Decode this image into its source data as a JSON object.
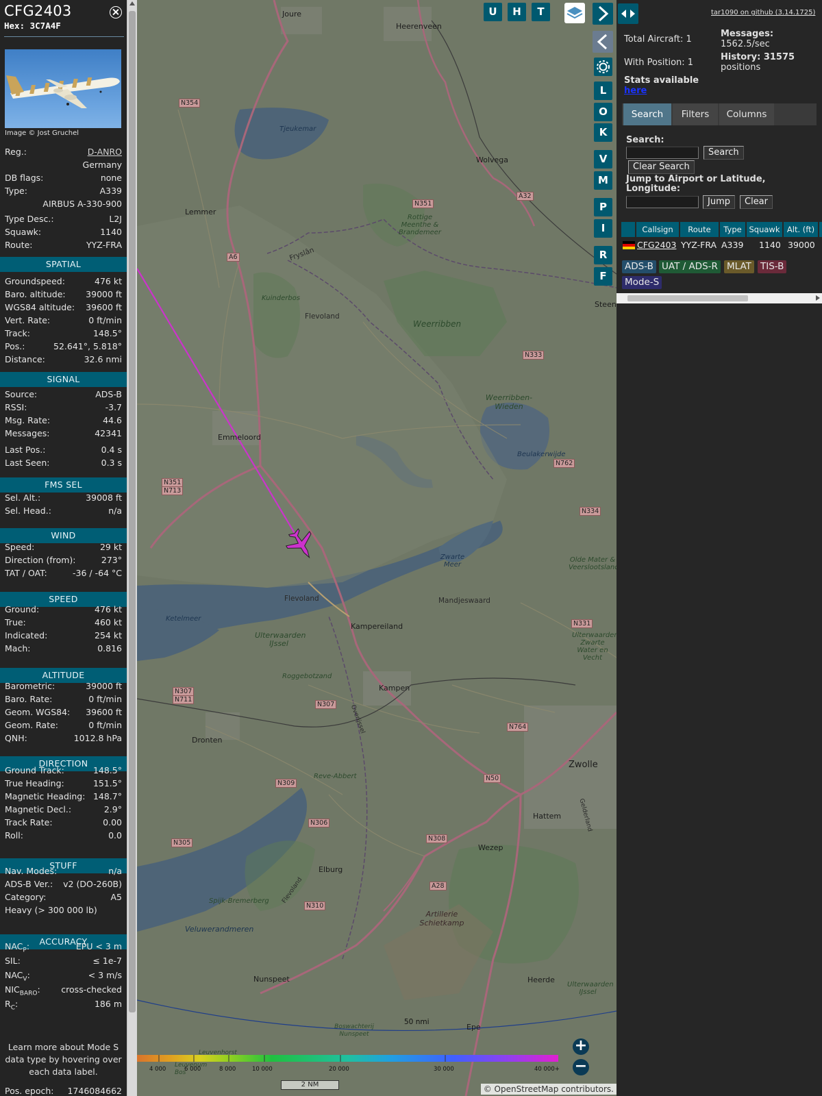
{
  "aircraft": {
    "callsign": "CFG2403",
    "hex": "Hex: 3C7A4F",
    "photo_credit": "Image © Jost Gruchel",
    "basic": [
      {
        "k": "Reg.:",
        "v": "D-ANRO"
      },
      {
        "k": "",
        "v": "Germany"
      },
      {
        "k": "DB flags:",
        "v": "none"
      },
      {
        "k": "Type:",
        "v": "A339"
      },
      {
        "k": "",
        "v": "AIRBUS A-330-900"
      },
      {
        "k": "Type Desc.:",
        "v": "L2J"
      },
      {
        "k": "Squawk:",
        "v": "1140"
      },
      {
        "k": "Route:",
        "v": "YYZ-FRA"
      }
    ],
    "spatial_title": "SPATIAL",
    "spatial": [
      {
        "k": "Groundspeed:",
        "v": "476 kt"
      },
      {
        "k": "Baro. altitude:",
        "v": "39000 ft"
      },
      {
        "k": "WGS84 altitude:",
        "v": "39600 ft"
      },
      {
        "k": "Vert. Rate:",
        "v": "0 ft/min"
      },
      {
        "k": "Track:",
        "v": "148.5°"
      },
      {
        "k": "Pos.:",
        "v": "52.641°, 5.818°"
      },
      {
        "k": "Distance:",
        "v": "32.6 nmi"
      }
    ],
    "signal_title": "SIGNAL",
    "signal": [
      {
        "k": "Source:",
        "v": "ADS-B"
      },
      {
        "k": "RSSI:",
        "v": "-3.7"
      },
      {
        "k": "Msg. Rate:",
        "v": "44.6"
      },
      {
        "k": "Messages:",
        "v": "42341"
      },
      {
        "k": "Last Pos.:",
        "v": "0.4 s"
      },
      {
        "k": "Last Seen:",
        "v": "0.3 s"
      }
    ],
    "fms_title": "FMS SEL",
    "fms": [
      {
        "k": "Sel. Alt.:",
        "v": "39008 ft"
      },
      {
        "k": "Sel. Head.:",
        "v": "n/a"
      }
    ],
    "wind_title": "WIND",
    "wind": [
      {
        "k": "Speed:",
        "v": "29 kt"
      },
      {
        "k": "Direction (from):",
        "v": "273°"
      },
      {
        "k": "TAT / OAT:",
        "v": "-36 / -64 °C"
      }
    ],
    "speed_title": "SPEED",
    "speed": [
      {
        "k": "Ground:",
        "v": "476 kt"
      },
      {
        "k": "True:",
        "v": "460 kt"
      },
      {
        "k": "Indicated:",
        "v": "254 kt"
      },
      {
        "k": "Mach:",
        "v": "0.816"
      }
    ],
    "altitude_title": "ALTITUDE",
    "altitude": [
      {
        "k": "Barometric:",
        "v": "39000 ft"
      },
      {
        "k": "Baro. Rate:",
        "v": "0 ft/min"
      },
      {
        "k": "Geom. WGS84:",
        "v": "39600 ft"
      },
      {
        "k": "Geom. Rate:",
        "v": "0 ft/min"
      },
      {
        "k": "QNH:",
        "v": "1012.8 hPa"
      }
    ],
    "direction_title": "DIRECTION",
    "direction": [
      {
        "k": "Ground Track:",
        "v": "148.5°"
      },
      {
        "k": "True Heading:",
        "v": "151.5°"
      },
      {
        "k": "Magnetic Heading:",
        "v": "148.7°"
      },
      {
        "k": "Magnetic Decl.:",
        "v": "2.9°"
      },
      {
        "k": "Track Rate:",
        "v": "0.00"
      },
      {
        "k": "Roll:",
        "v": "0.0"
      }
    ],
    "stuff_title": "STUFF",
    "stuff": [
      {
        "k": "Nav. Modes:",
        "v": "n/a"
      },
      {
        "k": "ADS-B Ver.:",
        "v": "v2 (DO-260B)"
      },
      {
        "k": "Category:",
        "v": "A5"
      },
      {
        "k": "Heavy (> 300 000 lb)",
        "v": ""
      }
    ],
    "accuracy_title": "ACCURACY",
    "accuracy": [
      {
        "k": "NAC",
        "sub": "P",
        "v": "EPU < 3 m"
      },
      {
        "k": "SIL:",
        "sub": "",
        "v": "≤ 1e-7"
      },
      {
        "k": "NAC",
        "sub": "V",
        "v": "< 3 m/s"
      },
      {
        "k": "NIC",
        "sub": "BARO",
        "v": "cross-checked"
      },
      {
        "k": "R",
        "sub": "C",
        "v": "186 m"
      }
    ],
    "footnote": "Learn more about Mode S data type by hovering over each data label.",
    "pos_epoch_label": "Pos. epoch:",
    "pos_epoch": "1746084662"
  },
  "map": {
    "buttons": [
      "U",
      "H",
      "T"
    ],
    "side_buttons": [
      "L",
      "O",
      "K",
      "V",
      "M",
      "P",
      "I",
      "R",
      "F"
    ],
    "range_ring_label": "50 nmi",
    "scale_label": "2 NM",
    "attribution": "© OpenStreetMap contributors.",
    "legend_ticks": [
      "4 000",
      "6 000",
      "8 000",
      "10 000",
      "20 000",
      "30 000",
      "40 000+"
    ],
    "places": [
      "Joure",
      "Heerenveen",
      "Wolvega",
      "Lemmer",
      "Emmeloord",
      "Steenw",
      "Flevoland",
      "Kampereiland",
      "Kampen",
      "Dronten",
      "Elburg",
      "Wezep",
      "Hattem",
      "Zwolle",
      "Nunspeet",
      "Epe",
      "Heerde",
      "Mandjeswaard",
      "Flevoland",
      "Fryslân",
      "Overijssel",
      "Gelderland",
      "Flevoland"
    ],
    "nature": [
      "Tjeukemar",
      "Kuinderbos",
      "Weerribben",
      "Rottige Meenthe & Brandemeer",
      "Weerribben-Wieden",
      "Beulakerwijde",
      "Zwarte Meer",
      "Ketelmeer",
      "Ulterwaarden IJssel",
      "Roggebotzand",
      "Reve-Abbert",
      "Spijk-Bremerberg",
      "Veluwerandmeren",
      "Artillerie Schietkamp",
      "Olde Mater & Veerslootslanden",
      "Ulterwaarden Zwarte Water en Vecht",
      "Ulterwaarden IJssel",
      "Boswachterij Nunspeet",
      "Leuvenhorst",
      "Leuvenum Bos"
    ],
    "shields": [
      "N354",
      "N351",
      "A32",
      "A6",
      "N333",
      "N762",
      "N334",
      "N351",
      "N713",
      "N331",
      "N307",
      "N711",
      "N307",
      "N764",
      "N309",
      "N50",
      "N306",
      "N305",
      "N308",
      "A28",
      "N310"
    ]
  },
  "right": {
    "github_link": "tar1090 on github (3.14.1725)",
    "total_aircraft": "Total Aircraft: 1",
    "with_position": "With Position: 1",
    "stats_available": "Stats available",
    "stats_here": "here",
    "messages_label": "Messages:",
    "messages_value": "1562.5/sec",
    "history_label": "History: 31575",
    "history_value": "positions",
    "tabs": [
      "Search",
      "Filters",
      "Columns"
    ],
    "search_label": "Search:",
    "search_button": "Search",
    "clear_search_button": "Clear Search",
    "jump_label": "Jump to Airport or Latitude, Longitude:",
    "jump_button": "Jump",
    "clear_button": "Clear",
    "table": {
      "headers": [
        "Callsign",
        "Route",
        "Type",
        "Squawk",
        "Alt. (ft)"
      ],
      "row": [
        "CFG2403",
        "YYZ-FRA",
        "A339",
        "1140",
        "39000"
      ]
    },
    "badges": [
      {
        "label": "ADS-B",
        "color": "#244e6b"
      },
      {
        "label": "UAT / ADS-R",
        "color": "#1f5a35"
      },
      {
        "label": "MLAT",
        "color": "#6a5a2a"
      },
      {
        "label": "TIS-B",
        "color": "#6a2a3a"
      },
      {
        "label": "Mode-S",
        "color": "#2e2c6b"
      }
    ]
  },
  "colors": {
    "accent": "#005e75",
    "track_line": "#cc33cc",
    "panel_bg": "#242424"
  }
}
